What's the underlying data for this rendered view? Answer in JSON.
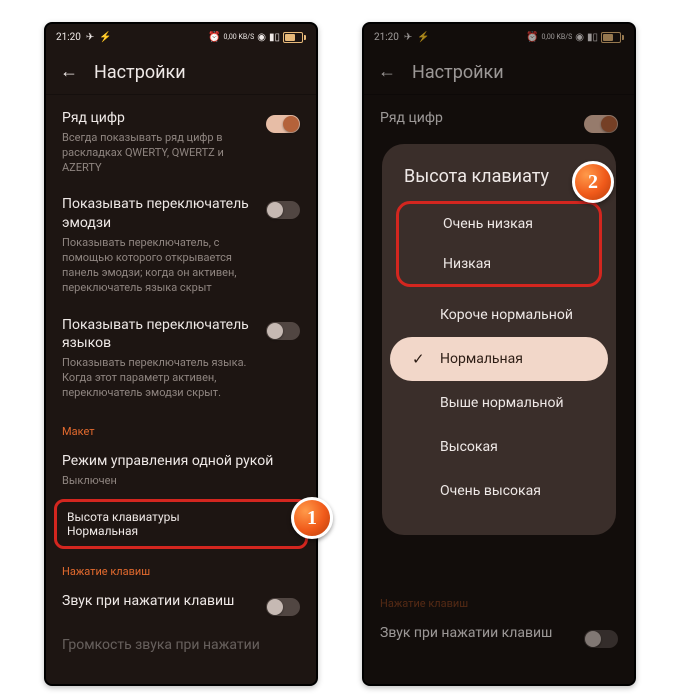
{
  "statusbar": {
    "time": "21:20",
    "kbs": "0,00 KB/S"
  },
  "header": {
    "title": "Настройки"
  },
  "settings": {
    "row_digits": {
      "title": "Ряд цифр",
      "desc": "Всегда показывать ряд цифр в раскладках QWERTY, QWERTZ и AZERTY"
    },
    "emoji_switch": {
      "title": "Показывать переключатель эмодзи",
      "desc": "Показывать переключатель, с помощью которого открывается панель эмодзи; когда он активен, переключатель языка скрыт"
    },
    "lang_switch": {
      "title": "Показывать переключатель языков",
      "desc": "Показывать переключатель языка. Когда этот параметр активен, переключатель эмодзи скрыт."
    },
    "section_layout": "Макет",
    "one_hand": {
      "title": "Режим управления одной рукой",
      "sub": "Выключен"
    },
    "kb_height": {
      "title": "Высота клавиатуры",
      "sub": "Нормальная"
    },
    "section_keypress": "Нажатие клавиш",
    "sound": {
      "title": "Звук при нажатии клавиш"
    },
    "volume": {
      "title": "Громкость звука при нажатии"
    }
  },
  "dialog": {
    "title": "Высота клавиату",
    "options": [
      "Очень низкая",
      "Низкая",
      "Короче нормальной",
      "Нормальная",
      "Выше нормальной",
      "Высокая",
      "Очень высокая"
    ],
    "selected_index": 3
  },
  "markers": {
    "m1": "1",
    "m2": "2"
  }
}
